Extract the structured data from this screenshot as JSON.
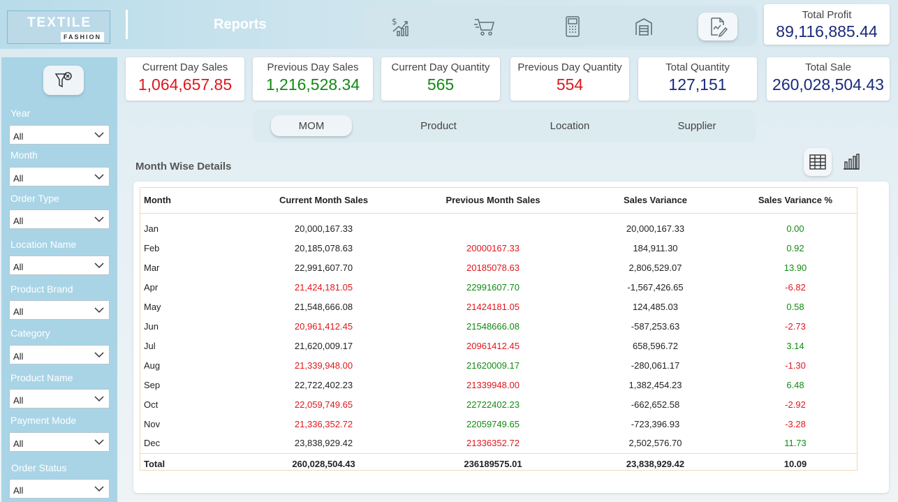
{
  "header": {
    "logo_main": "TEXTILE",
    "logo_sub": "FASHION",
    "title": "Reports",
    "nav_icons": [
      "sales-trend-icon",
      "cart-icon",
      "pos-terminal-icon",
      "warehouse-icon",
      "report-icon"
    ],
    "total_profit_label": "Total Profit",
    "total_profit_value": "89,116,885.44"
  },
  "kpis": [
    {
      "label": "Current Day Sales",
      "value": "1,064,657.85",
      "color": "#e0161b"
    },
    {
      "label": "Previous Day Sales",
      "value": "1,216,528.34",
      "color": "#118a11"
    },
    {
      "label": "Current Day Quantity",
      "value": "565",
      "color": "#118a11"
    },
    {
      "label": "Previous Day Quantity",
      "value": "554",
      "color": "#e0161b"
    },
    {
      "label": "Total Quantity",
      "value": "127,151",
      "color": "#1a2a7a"
    },
    {
      "label": "Total Sale",
      "value": "260,028,504.43",
      "color": "#1a2a7a"
    }
  ],
  "filters": [
    {
      "label": "Year",
      "value": "All"
    },
    {
      "label": "Month",
      "value": "All"
    },
    {
      "label": "Order Type",
      "value": "All"
    },
    {
      "label": "Location Name",
      "value": "All"
    },
    {
      "label": "Product Brand",
      "value": "All"
    },
    {
      "label": "Category",
      "value": "All"
    },
    {
      "label": "Product Name",
      "value": "All"
    },
    {
      "label": "Payment Mode",
      "value": "All"
    },
    {
      "label": "Order Status",
      "value": "All"
    }
  ],
  "tabs": [
    {
      "label": "MOM",
      "active": true
    },
    {
      "label": "Product",
      "active": false
    },
    {
      "label": "Location",
      "active": false
    },
    {
      "label": "Supplier",
      "active": false
    }
  ],
  "section": {
    "title": "Month Wise Details",
    "view_icons": [
      "table-view-icon",
      "chart-view-icon"
    ]
  },
  "table": {
    "columns": [
      "Month",
      "Current Month Sales",
      "Previous Month Sales",
      "Sales Variance",
      "Sales Variance %"
    ],
    "rows": [
      {
        "month": "Jan",
        "current": "20,000,167.33",
        "current_color": "black",
        "previous": "",
        "previous_color": "black",
        "variance": "20,000,167.33",
        "pct": "0.00",
        "pct_color": "green"
      },
      {
        "month": "Feb",
        "current": "20,185,078.63",
        "current_color": "black",
        "previous": "20000167.33",
        "previous_color": "red",
        "variance": "184,911.30",
        "pct": "0.92",
        "pct_color": "green"
      },
      {
        "month": "Mar",
        "current": "22,991,607.70",
        "current_color": "black",
        "previous": "20185078.63",
        "previous_color": "red",
        "variance": "2,806,529.07",
        "pct": "13.90",
        "pct_color": "green"
      },
      {
        "month": "Apr",
        "current": "21,424,181.05",
        "current_color": "red",
        "previous": "22991607.70",
        "previous_color": "green",
        "variance": "-1,567,426.65",
        "pct": "-6.82",
        "pct_color": "red"
      },
      {
        "month": "May",
        "current": "21,548,666.08",
        "current_color": "black",
        "previous": "21424181.05",
        "previous_color": "red",
        "variance": "124,485.03",
        "pct": "0.58",
        "pct_color": "green"
      },
      {
        "month": "Jun",
        "current": "20,961,412.45",
        "current_color": "red",
        "previous": "21548666.08",
        "previous_color": "green",
        "variance": "-587,253.63",
        "pct": "-2.73",
        "pct_color": "red"
      },
      {
        "month": "Jul",
        "current": "21,620,009.17",
        "current_color": "black",
        "previous": "20961412.45",
        "previous_color": "red",
        "variance": "658,596.72",
        "pct": "3.14",
        "pct_color": "green"
      },
      {
        "month": "Aug",
        "current": "21,339,948.00",
        "current_color": "red",
        "previous": "21620009.17",
        "previous_color": "green",
        "variance": "-280,061.17",
        "pct": "-1.30",
        "pct_color": "red"
      },
      {
        "month": "Sep",
        "current": "22,722,402.23",
        "current_color": "black",
        "previous": "21339948.00",
        "previous_color": "red",
        "variance": "1,382,454.23",
        "pct": "6.48",
        "pct_color": "green"
      },
      {
        "month": "Oct",
        "current": "22,059,749.65",
        "current_color": "red",
        "previous": "22722402.23",
        "previous_color": "green",
        "variance": "-662,652.58",
        "pct": "-2.92",
        "pct_color": "red"
      },
      {
        "month": "Nov",
        "current": "21,336,352.72",
        "current_color": "red",
        "previous": "22059749.65",
        "previous_color": "green",
        "variance": "-723,396.93",
        "pct": "-3.28",
        "pct_color": "red"
      },
      {
        "month": "Dec",
        "current": "23,838,929.42",
        "current_color": "black",
        "previous": "21336352.72",
        "previous_color": "red",
        "variance": "2,502,576.70",
        "pct": "11.73",
        "pct_color": "green"
      }
    ],
    "total": {
      "month": "Total",
      "current": "260,028,504.43",
      "previous": "236189575.01",
      "variance": "23,838,929.42",
      "pct": "10.09"
    }
  }
}
